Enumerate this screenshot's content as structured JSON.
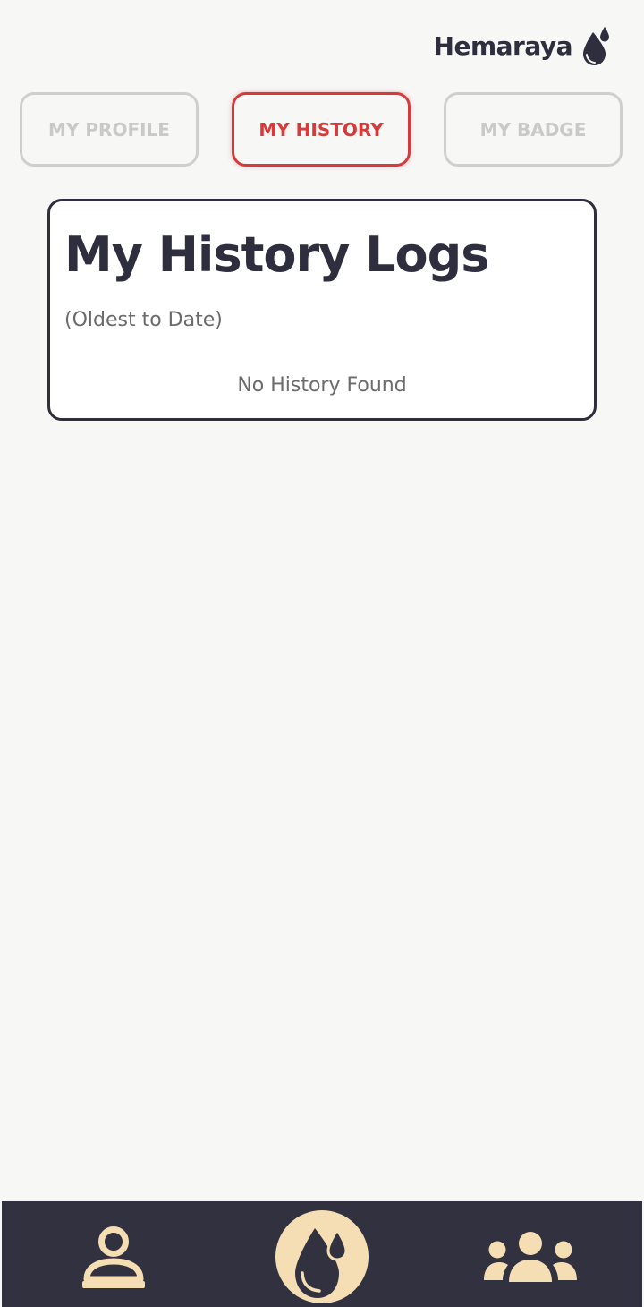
{
  "header": {
    "brand_name": "Hemaraya",
    "brand_icon": "blood-drops-icon"
  },
  "tabs": [
    {
      "label": "MY PROFILE",
      "active": false
    },
    {
      "label": "MY HISTORY",
      "active": true
    },
    {
      "label": "MY BADGE",
      "active": false
    }
  ],
  "history_card": {
    "title": "My History Logs",
    "subtitle": "(Oldest to Date)",
    "empty_message": "No History Found"
  },
  "bottom_nav": {
    "items": [
      {
        "icon": "person-icon"
      },
      {
        "icon": "blood-drop-icon"
      },
      {
        "icon": "group-icon"
      }
    ]
  },
  "colors": {
    "background": "#f7f7f6",
    "dark": "#2e2e3e",
    "accent_red": "#d63a3a",
    "inactive_tab": "#c9c9c9",
    "nav_background": "#32313f",
    "nav_icon": "#f5deb3"
  }
}
